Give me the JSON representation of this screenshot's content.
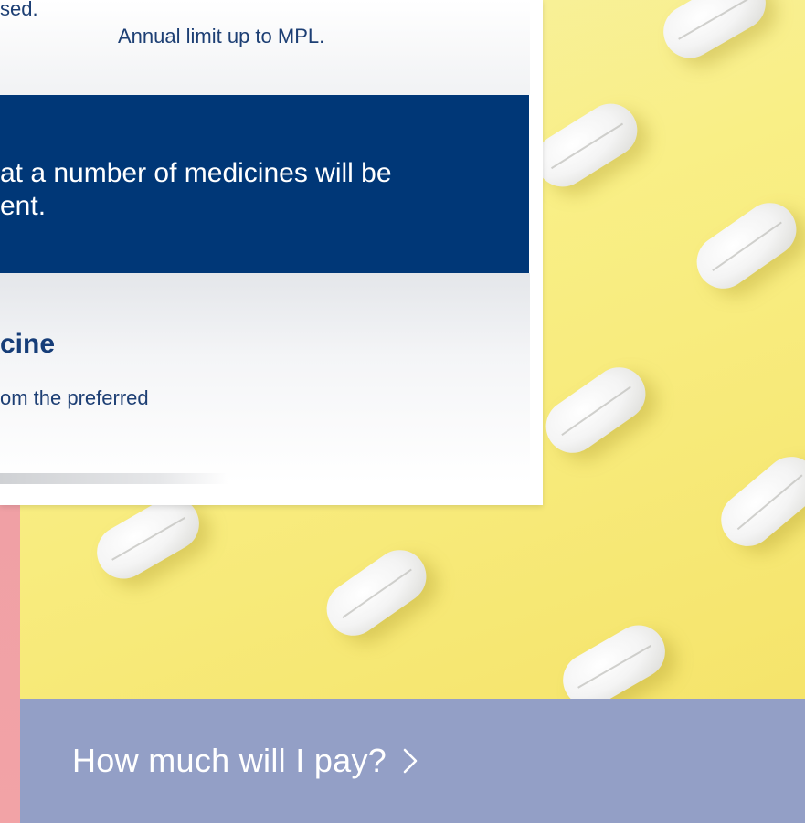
{
  "card": {
    "fragment_top": "sed.",
    "annual_limit": "Annual limit up to MPL.",
    "band_text_line1": "at a number of medicines will be",
    "band_text_line2": "ent.",
    "heading": "cine",
    "subtext": "om the preferred"
  },
  "cta": {
    "label": "How much will I pay?",
    "icon": "chevron-right-icon"
  },
  "colors": {
    "navy_band": "#003777",
    "cta_bar": "#939fc6",
    "heading_text": "#163d78",
    "pink_accent": "#d98f94",
    "yellow_photo": "#f9ef86"
  }
}
